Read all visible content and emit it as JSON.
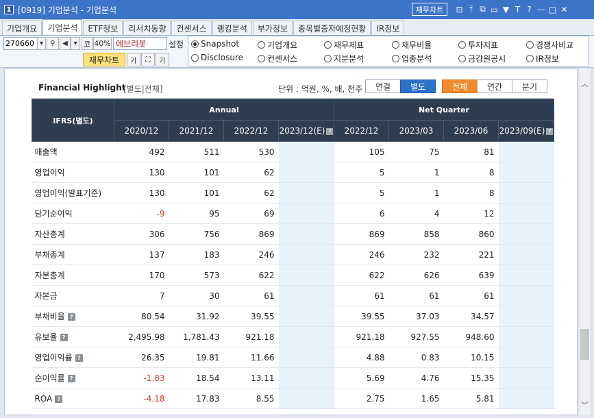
{
  "window": {
    "number": "1",
    "title": "[0919] 기업분석 - 기업분석",
    "chart_button": "재무차트",
    "icons": [
      "chart-icon",
      "pin-icon",
      "copy-icon",
      "window-icon",
      "thumbtack-icon",
      "text-size-icon",
      "help-icon",
      "minimize-icon",
      "maximize-icon",
      "close-icon"
    ],
    "icon_glyphs": [
      "⊡",
      "⤒",
      "⧉",
      "▭",
      "▼",
      "T",
      "?",
      "—",
      "□",
      "✕"
    ]
  },
  "tabs": [
    {
      "label": "기업개요",
      "active": false
    },
    {
      "label": "기업분석",
      "active": true
    },
    {
      "label": "ETF정보",
      "active": false
    },
    {
      "label": "리서치동향",
      "active": false
    },
    {
      "label": "컨센서스",
      "active": false
    },
    {
      "label": "랭킹분석",
      "active": false
    },
    {
      "label": "부가정보",
      "active": false
    },
    {
      "label": "종목별증자예정현황",
      "active": false
    },
    {
      "label": "IR정보",
      "active": false
    }
  ],
  "toolbar": {
    "code": "270660",
    "market": "코",
    "ratio": "40%",
    "name": "에브리봇",
    "settings": "설정",
    "fin_chart": "재무차트",
    "small_glyphs": {
      "lang": "가",
      "expand": "⛶",
      "font": "가"
    }
  },
  "radio_options": [
    {
      "label": "Snapshot",
      "checked": true
    },
    {
      "label": "기업개요",
      "checked": false
    },
    {
      "label": "재무제표",
      "checked": false
    },
    {
      "label": "재무비율",
      "checked": false
    },
    {
      "label": "투자지표",
      "checked": false
    },
    {
      "label": "경쟁사비교",
      "checked": false
    },
    {
      "label": "Disclosure",
      "checked": false
    },
    {
      "label": "컨센서스",
      "checked": false
    },
    {
      "label": "지분분석",
      "checked": false
    },
    {
      "label": "업종분석",
      "checked": false
    },
    {
      "label": "금감원공시",
      "checked": false
    },
    {
      "label": "IR정보",
      "checked": false
    }
  ],
  "highlight": {
    "title": "Financial Highlight",
    "subtitle": "[별도|전체]",
    "unit": "단위 : 억원, %, 배, 천주",
    "consolidated_btn": "연결",
    "separate_btn": "별도",
    "all_btn": "전체",
    "annual_btn": "연간",
    "quarter_btn": "분기"
  },
  "table": {
    "corner": "IFRS(별도)",
    "group_annual": "Annual",
    "group_quarter": "Net Quarter",
    "periods": [
      "2020/12",
      "2021/12",
      "2022/12",
      "2023/12(E)",
      "2022/12",
      "2023/03",
      "2023/06",
      "2023/09(E)"
    ],
    "rows": [
      {
        "label": "매출액",
        "help": false,
        "values": [
          "492",
          "511",
          "530",
          "",
          "105",
          "75",
          "81",
          ""
        ]
      },
      {
        "label": "영업이익",
        "help": false,
        "values": [
          "130",
          "101",
          "62",
          "",
          "5",
          "1",
          "8",
          ""
        ]
      },
      {
        "label": "영업이익(발표기준)",
        "help": false,
        "values": [
          "130",
          "101",
          "62",
          "",
          "5",
          "1",
          "8",
          ""
        ]
      },
      {
        "label": "당기순이익",
        "help": false,
        "values": [
          "-9",
          "95",
          "69",
          "",
          "6",
          "4",
          "12",
          ""
        ]
      },
      {
        "label": "자산총계",
        "help": false,
        "values": [
          "306",
          "756",
          "869",
          "",
          "869",
          "858",
          "860",
          ""
        ]
      },
      {
        "label": "부채총계",
        "help": false,
        "values": [
          "137",
          "183",
          "246",
          "",
          "246",
          "232",
          "221",
          ""
        ]
      },
      {
        "label": "자본총계",
        "help": false,
        "values": [
          "170",
          "573",
          "622",
          "",
          "622",
          "626",
          "639",
          ""
        ]
      },
      {
        "label": "자본금",
        "help": false,
        "values": [
          "7",
          "30",
          "61",
          "",
          "61",
          "61",
          "61",
          ""
        ]
      },
      {
        "label": "부채비율",
        "help": true,
        "values": [
          "80.54",
          "31.92",
          "39.55",
          "",
          "39.55",
          "37.03",
          "34.57",
          ""
        ]
      },
      {
        "label": "유보율",
        "help": true,
        "values": [
          "2,495.98",
          "1,781.43",
          "921.18",
          "",
          "921.18",
          "927.55",
          "948.60",
          ""
        ]
      },
      {
        "label": "영업이익률",
        "help": true,
        "values": [
          "26.35",
          "19.81",
          "11.66",
          "",
          "4.88",
          "0.83",
          "10.15",
          ""
        ]
      },
      {
        "label": "순이익률",
        "help": true,
        "values": [
          "-1.83",
          "18.54",
          "13.11",
          "",
          "5.69",
          "4.76",
          "15.35",
          ""
        ]
      },
      {
        "label": "ROA",
        "help": true,
        "values": [
          "-4.18",
          "17.83",
          "8.55",
          "",
          "2.75",
          "1.65",
          "5.81",
          ""
        ]
      }
    ]
  },
  "colors": {
    "negative": "#d43a2a",
    "header_bg": "#2f3d50",
    "estimate_bg": "#e6f3fb",
    "accent_blue": "#2b73c9",
    "accent_orange": "#f08a2d"
  }
}
